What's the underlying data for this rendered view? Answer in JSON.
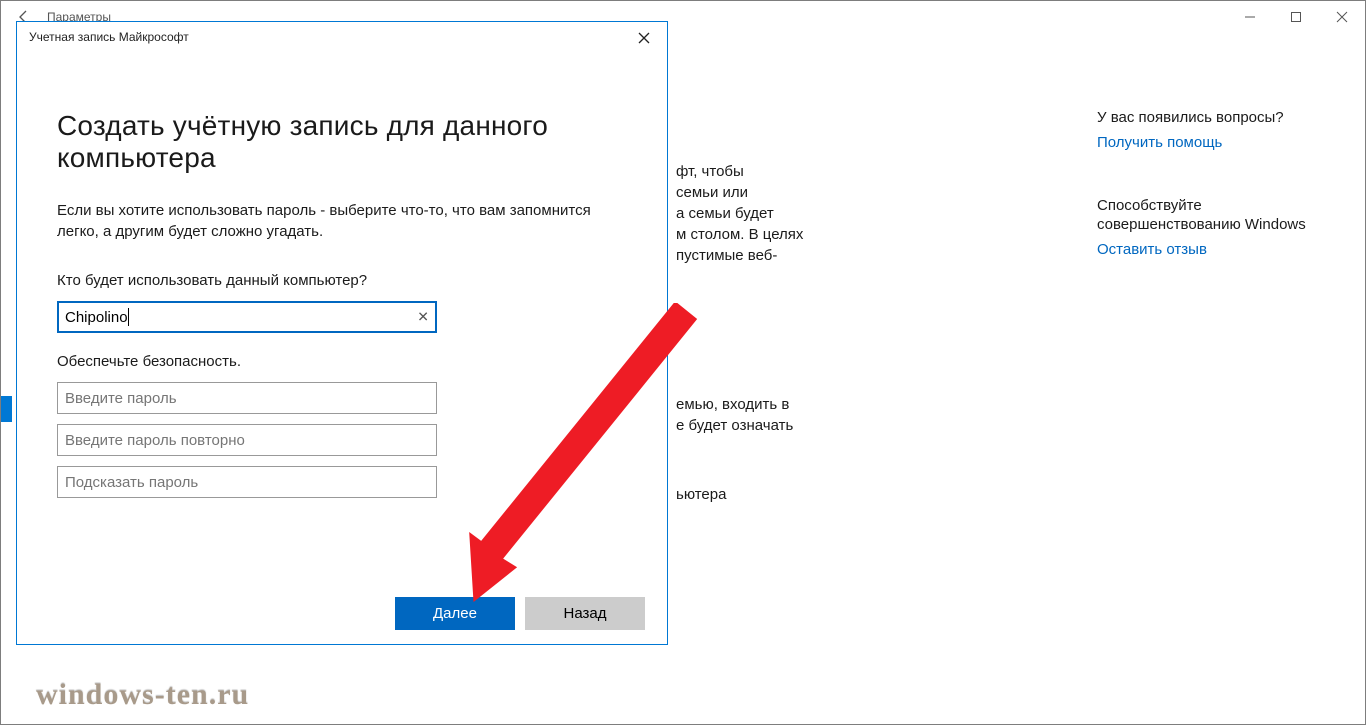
{
  "backWindow": {
    "title": "Параметры"
  },
  "bg": {
    "para1": "фт, чтобы\nсемьи или\nа семьи будет\nм столом. В целях\nпустимые веб-",
    "para2": "емью, входить в\nе будет означать",
    "para3": "ьютера"
  },
  "side": {
    "question": "У вас появились вопросы?",
    "helpLink": "Получить помощь",
    "feedback1": "Способствуйте",
    "feedback2": "совершенствованию Windows",
    "feedbackLink": "Оставить отзыв"
  },
  "modal": {
    "title": "Учетная запись Майкрософт",
    "heading": "Создать учётную запись для данного компьютера",
    "desc": "Если вы хотите использовать пароль - выберите что-то, что вам запомнится легко, а другим будет сложно угадать.",
    "label1": "Кто будет использовать данный компьютер?",
    "username": "Chipolino",
    "label2": "Обеспечьте безопасность.",
    "passwordPlaceholder": "Введите пароль",
    "password2Placeholder": "Введите пароль повторно",
    "hintPlaceholder": "Подсказать пароль",
    "next": "Далее",
    "back": "Назад"
  },
  "watermark": "windows-ten.ru"
}
